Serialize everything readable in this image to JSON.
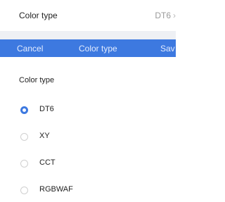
{
  "setting_row": {
    "label": "Color type",
    "value": "DT6"
  },
  "topbar": {
    "cancel": "Cancel",
    "title": "Color type",
    "save": "Sav"
  },
  "section": {
    "title": "Color type"
  },
  "options": [
    {
      "label": "DT6",
      "selected": true
    },
    {
      "label": "XY",
      "selected": false
    },
    {
      "label": "CCT",
      "selected": false
    },
    {
      "label": "RGBWAF",
      "selected": false
    }
  ],
  "colors": {
    "accent": "#3d79e0",
    "separator": "#eef0f4"
  }
}
